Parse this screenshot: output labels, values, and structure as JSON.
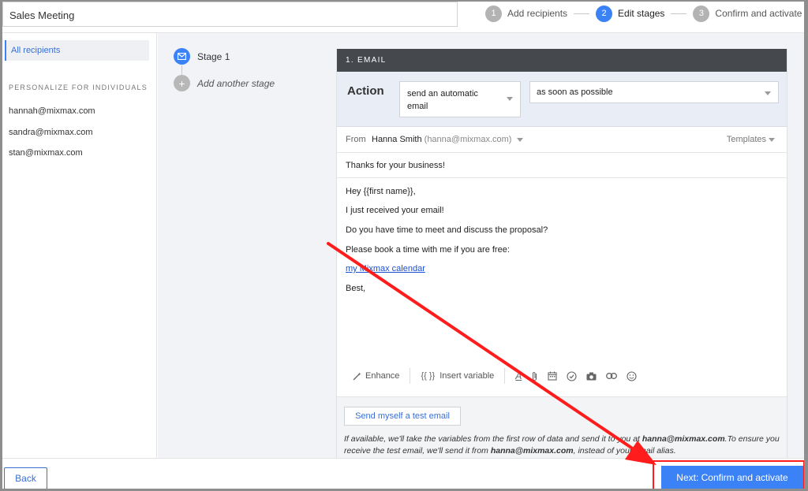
{
  "header": {
    "campaign_name": "Sales Meeting",
    "steps": [
      {
        "num": "1",
        "label": "Add recipients"
      },
      {
        "num": "2",
        "label": "Edit stages"
      },
      {
        "num": "3",
        "label": "Confirm and activate"
      }
    ]
  },
  "sidebar": {
    "all_recipients": "All recipients",
    "section_title": "PERSONALIZE FOR INDIVIDUALS",
    "recipients": [
      "hannah@mixmax.com",
      "sandra@mixmax.com",
      "stan@mixmax.com"
    ]
  },
  "stages": {
    "stage1": "Stage 1",
    "add": "Add another stage"
  },
  "email": {
    "card_title": "1. EMAIL",
    "action_label": "Action",
    "action_select": "send an automatic email",
    "timing_select": "as soon as possible",
    "from_label": "From",
    "from_name": "Hanna Smith",
    "from_email": "(hanna@mixmax.com)",
    "templates": "Templates",
    "subject": "Thanks for your business!",
    "body": [
      "Hey {{first name}},",
      "I just received your email!",
      "Do you have time to meet and discuss the proposal?",
      "Please book a time with me if you are free:"
    ],
    "link": "my Mixmax calendar",
    "signoff": "Best,",
    "toolbar": {
      "enhance": "Enhance",
      "variable_glyph": "{{ }}",
      "insert_variable": "Insert variable"
    },
    "test_button": "Send myself a test email",
    "test_note_1": "If available, we'll take the variables from the first row of data and send it to you at ",
    "test_note_email_1": "hanna@mixmax.com",
    "test_note_2": ".To ensure you receive the test email, we'll send it from ",
    "test_note_email_2": "hanna@mixmax.com",
    "test_note_3": ", instead of your email alias."
  },
  "footer": {
    "back": "Back",
    "next": "Next: Confirm and activate"
  },
  "colors": {
    "accent": "#3b82f6",
    "annotation": "#ff1c1c",
    "card_header": "#45484d"
  }
}
